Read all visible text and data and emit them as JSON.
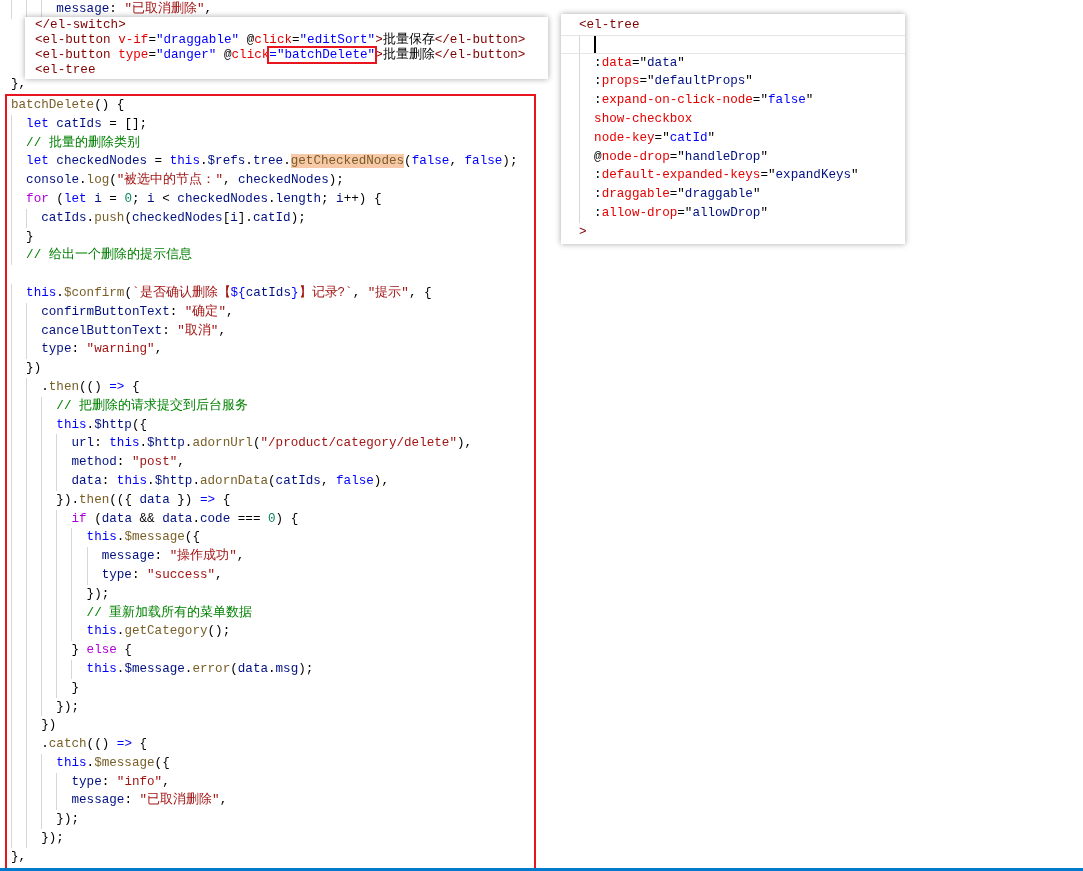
{
  "editor": {
    "top_lines": [
      {
        "kind": "code",
        "segments": [
          {
            "kind": "v",
            "text": "      message"
          },
          {
            "kind": "p",
            "text": ": "
          },
          {
            "kind": "s",
            "text": "\"已取消删除\""
          },
          {
            "kind": "p",
            "text": ","
          }
        ]
      },
      {
        "kind": "code",
        "segments": [
          {
            "kind": "p",
            "text": "},"
          }
        ]
      }
    ],
    "highlighted_block": {
      "lines": [
        {
          "kind": "code",
          "segments": [
            {
              "kind": "f",
              "text": "batchDelete"
            },
            {
              "kind": "p",
              "text": "() {"
            }
          ]
        },
        {
          "kind": "code",
          "segments": [
            {
              "kind": "kw",
              "text": "  let "
            },
            {
              "kind": "v",
              "text": "catIds"
            },
            {
              "kind": "p",
              "text": " = [];"
            }
          ]
        },
        {
          "kind": "code",
          "segments": [
            {
              "kind": "c",
              "text": "  // 批量的删除类别"
            }
          ]
        },
        {
          "kind": "code",
          "segments": [
            {
              "kind": "kw",
              "text": "  let "
            },
            {
              "kind": "v",
              "text": "checkedNodes"
            },
            {
              "kind": "p",
              "text": " = "
            },
            {
              "kind": "kw",
              "text": "this"
            },
            {
              "kind": "p",
              "text": "."
            },
            {
              "kind": "v",
              "text": "$refs"
            },
            {
              "kind": "p",
              "text": "."
            },
            {
              "kind": "v",
              "text": "tree"
            },
            {
              "kind": "p",
              "text": "."
            },
            {
              "kind": "hl",
              "text": "getCheckedNodes"
            },
            {
              "kind": "p",
              "text": "("
            },
            {
              "kind": "kw",
              "text": "false"
            },
            {
              "kind": "p",
              "text": ", "
            },
            {
              "kind": "kw",
              "text": "false"
            },
            {
              "kind": "p",
              "text": ");"
            }
          ]
        },
        {
          "kind": "code",
          "segments": [
            {
              "kind": "v",
              "text": "  console"
            },
            {
              "kind": "p",
              "text": "."
            },
            {
              "kind": "f",
              "text": "log"
            },
            {
              "kind": "p",
              "text": "("
            },
            {
              "kind": "s",
              "text": "\"被选中的节点：\""
            },
            {
              "kind": "p",
              "text": ", "
            },
            {
              "kind": "v",
              "text": "checkedNodes"
            },
            {
              "kind": "p",
              "text": ");"
            }
          ]
        },
        {
          "kind": "code",
          "segments": [
            {
              "kind": "ctl",
              "text": "  for"
            },
            {
              "kind": "p",
              "text": " ("
            },
            {
              "kind": "kw",
              "text": "let "
            },
            {
              "kind": "v",
              "text": "i"
            },
            {
              "kind": "p",
              "text": " = "
            },
            {
              "kind": "n",
              "text": "0"
            },
            {
              "kind": "p",
              "text": "; "
            },
            {
              "kind": "v",
              "text": "i"
            },
            {
              "kind": "p",
              "text": " < "
            },
            {
              "kind": "v",
              "text": "checkedNodes"
            },
            {
              "kind": "p",
              "text": "."
            },
            {
              "kind": "v",
              "text": "length"
            },
            {
              "kind": "p",
              "text": "; "
            },
            {
              "kind": "v",
              "text": "i"
            },
            {
              "kind": "p",
              "text": "++) {"
            }
          ]
        },
        {
          "kind": "code",
          "segments": [
            {
              "kind": "v",
              "text": "    catIds"
            },
            {
              "kind": "p",
              "text": "."
            },
            {
              "kind": "f",
              "text": "push"
            },
            {
              "kind": "p",
              "text": "("
            },
            {
              "kind": "v",
              "text": "checkedNodes"
            },
            {
              "kind": "p",
              "text": "["
            },
            {
              "kind": "v",
              "text": "i"
            },
            {
              "kind": "p",
              "text": "]."
            },
            {
              "kind": "v",
              "text": "catId"
            },
            {
              "kind": "p",
              "text": ");"
            }
          ]
        },
        {
          "kind": "code",
          "segments": [
            {
              "kind": "p",
              "text": "  }"
            }
          ]
        },
        {
          "kind": "code",
          "segments": [
            {
              "kind": "c",
              "text": "  // 给出一个删除的提示信息"
            }
          ]
        },
        {
          "kind": "blank"
        },
        {
          "kind": "code",
          "segments": [
            {
              "kind": "kw",
              "text": "  this"
            },
            {
              "kind": "p",
              "text": "."
            },
            {
              "kind": "f",
              "text": "$confirm"
            },
            {
              "kind": "p",
              "text": "("
            },
            {
              "kind": "s",
              "text": "`是否确认删除【"
            },
            {
              "kind": "kw",
              "text": "${"
            },
            {
              "kind": "v",
              "text": "catIds"
            },
            {
              "kind": "kw",
              "text": "}"
            },
            {
              "kind": "s",
              "text": "】记录?`"
            },
            {
              "kind": "p",
              "text": ", "
            },
            {
              "kind": "s",
              "text": "\"提示\""
            },
            {
              "kind": "p",
              "text": ", {"
            }
          ]
        },
        {
          "kind": "code",
          "segments": [
            {
              "kind": "v",
              "text": "    confirmButtonText"
            },
            {
              "kind": "p",
              "text": ": "
            },
            {
              "kind": "s",
              "text": "\"确定\""
            },
            {
              "kind": "p",
              "text": ","
            }
          ]
        },
        {
          "kind": "code",
          "segments": [
            {
              "kind": "v",
              "text": "    cancelButtonText"
            },
            {
              "kind": "p",
              "text": ": "
            },
            {
              "kind": "s",
              "text": "\"取消\""
            },
            {
              "kind": "p",
              "text": ","
            }
          ]
        },
        {
          "kind": "code",
          "segments": [
            {
              "kind": "v",
              "text": "    type"
            },
            {
              "kind": "p",
              "text": ": "
            },
            {
              "kind": "s",
              "text": "\"warning\""
            },
            {
              "kind": "p",
              "text": ","
            }
          ]
        },
        {
          "kind": "code",
          "segments": [
            {
              "kind": "p",
              "text": "  })"
            }
          ]
        },
        {
          "kind": "code",
          "segments": [
            {
              "kind": "p",
              "text": "    ."
            },
            {
              "kind": "f",
              "text": "then"
            },
            {
              "kind": "p",
              "text": "(() "
            },
            {
              "kind": "kw",
              "text": "=>"
            },
            {
              "kind": "p",
              "text": " {"
            }
          ]
        },
        {
          "kind": "code",
          "segments": [
            {
              "kind": "c",
              "text": "      // 把删除的请求提交到后台服务"
            }
          ]
        },
        {
          "kind": "code",
          "segments": [
            {
              "kind": "kw",
              "text": "      this"
            },
            {
              "kind": "p",
              "text": "."
            },
            {
              "kind": "v",
              "text": "$http"
            },
            {
              "kind": "p",
              "text": "({"
            }
          ]
        },
        {
          "kind": "code",
          "segments": [
            {
              "kind": "v",
              "text": "        url"
            },
            {
              "kind": "p",
              "text": ": "
            },
            {
              "kind": "kw",
              "text": "this"
            },
            {
              "kind": "p",
              "text": "."
            },
            {
              "kind": "v",
              "text": "$http"
            },
            {
              "kind": "p",
              "text": "."
            },
            {
              "kind": "f",
              "text": "adornUrl"
            },
            {
              "kind": "p",
              "text": "("
            },
            {
              "kind": "s",
              "text": "\"/product/category/delete\""
            },
            {
              "kind": "p",
              "text": "),"
            }
          ]
        },
        {
          "kind": "code",
          "segments": [
            {
              "kind": "v",
              "text": "        method"
            },
            {
              "kind": "p",
              "text": ": "
            },
            {
              "kind": "s",
              "text": "\"post\""
            },
            {
              "kind": "p",
              "text": ","
            }
          ]
        },
        {
          "kind": "code",
          "segments": [
            {
              "kind": "v",
              "text": "        data"
            },
            {
              "kind": "p",
              "text": ": "
            },
            {
              "kind": "kw",
              "text": "this"
            },
            {
              "kind": "p",
              "text": "."
            },
            {
              "kind": "v",
              "text": "$http"
            },
            {
              "kind": "p",
              "text": "."
            },
            {
              "kind": "f",
              "text": "adornData"
            },
            {
              "kind": "p",
              "text": "("
            },
            {
              "kind": "v",
              "text": "catIds"
            },
            {
              "kind": "p",
              "text": ", "
            },
            {
              "kind": "kw",
              "text": "false"
            },
            {
              "kind": "p",
              "text": "),"
            }
          ]
        },
        {
          "kind": "code",
          "segments": [
            {
              "kind": "p",
              "text": "      })."
            },
            {
              "kind": "f",
              "text": "then"
            },
            {
              "kind": "p",
              "text": "(({ "
            },
            {
              "kind": "v",
              "text": "data"
            },
            {
              "kind": "p",
              "text": " }) "
            },
            {
              "kind": "kw",
              "text": "=>"
            },
            {
              "kind": "p",
              "text": " {"
            }
          ]
        },
        {
          "kind": "code",
          "segments": [
            {
              "kind": "ctl",
              "text": "        if"
            },
            {
              "kind": "p",
              "text": " ("
            },
            {
              "kind": "v",
              "text": "data"
            },
            {
              "kind": "p",
              "text": " && "
            },
            {
              "kind": "v",
              "text": "data"
            },
            {
              "kind": "p",
              "text": "."
            },
            {
              "kind": "v",
              "text": "code"
            },
            {
              "kind": "p",
              "text": " === "
            },
            {
              "kind": "n",
              "text": "0"
            },
            {
              "kind": "p",
              "text": ") {"
            }
          ]
        },
        {
          "kind": "code",
          "segments": [
            {
              "kind": "kw",
              "text": "          this"
            },
            {
              "kind": "p",
              "text": "."
            },
            {
              "kind": "f",
              "text": "$message"
            },
            {
              "kind": "p",
              "text": "({"
            }
          ]
        },
        {
          "kind": "code",
          "segments": [
            {
              "kind": "v",
              "text": "            message"
            },
            {
              "kind": "p",
              "text": ": "
            },
            {
              "kind": "s",
              "text": "\"操作成功\""
            },
            {
              "kind": "p",
              "text": ","
            }
          ]
        },
        {
          "kind": "code",
          "segments": [
            {
              "kind": "v",
              "text": "            type"
            },
            {
              "kind": "p",
              "text": ": "
            },
            {
              "kind": "s",
              "text": "\"success\""
            },
            {
              "kind": "p",
              "text": ","
            }
          ]
        },
        {
          "kind": "code",
          "segments": [
            {
              "kind": "p",
              "text": "          });"
            }
          ]
        },
        {
          "kind": "code",
          "segments": [
            {
              "kind": "c",
              "text": "          // 重新加载所有的菜单数据"
            }
          ]
        },
        {
          "kind": "code",
          "segments": [
            {
              "kind": "kw",
              "text": "          this"
            },
            {
              "kind": "p",
              "text": "."
            },
            {
              "kind": "f",
              "text": "getCategory"
            },
            {
              "kind": "p",
              "text": "();"
            }
          ]
        },
        {
          "kind": "code",
          "segments": [
            {
              "kind": "p",
              "text": "        } "
            },
            {
              "kind": "ctl",
              "text": "else"
            },
            {
              "kind": "p",
              "text": " {"
            }
          ]
        },
        {
          "kind": "code",
          "segments": [
            {
              "kind": "kw",
              "text": "          this"
            },
            {
              "kind": "p",
              "text": "."
            },
            {
              "kind": "v",
              "text": "$message"
            },
            {
              "kind": "p",
              "text": "."
            },
            {
              "kind": "f",
              "text": "error"
            },
            {
              "kind": "p",
              "text": "("
            },
            {
              "kind": "v",
              "text": "data"
            },
            {
              "kind": "p",
              "text": "."
            },
            {
              "kind": "v",
              "text": "msg"
            },
            {
              "kind": "p",
              "text": ");"
            }
          ]
        },
        {
          "kind": "code",
          "segments": [
            {
              "kind": "p",
              "text": "        }"
            }
          ]
        },
        {
          "kind": "code",
          "segments": [
            {
              "kind": "p",
              "text": "      });"
            }
          ]
        },
        {
          "kind": "code",
          "segments": [
            {
              "kind": "p",
              "text": "    })"
            }
          ]
        },
        {
          "kind": "code",
          "segments": [
            {
              "kind": "p",
              "text": "    ."
            },
            {
              "kind": "f",
              "text": "catch"
            },
            {
              "kind": "p",
              "text": "(() "
            },
            {
              "kind": "kw",
              "text": "=>"
            },
            {
              "kind": "p",
              "text": " {"
            }
          ]
        },
        {
          "kind": "code",
          "segments": [
            {
              "kind": "kw",
              "text": "      this"
            },
            {
              "kind": "p",
              "text": "."
            },
            {
              "kind": "f",
              "text": "$message"
            },
            {
              "kind": "p",
              "text": "({"
            }
          ]
        },
        {
          "kind": "code",
          "segments": [
            {
              "kind": "v",
              "text": "        type"
            },
            {
              "kind": "p",
              "text": ": "
            },
            {
              "kind": "s",
              "text": "\"info\""
            },
            {
              "kind": "p",
              "text": ","
            }
          ]
        },
        {
          "kind": "code",
          "segments": [
            {
              "kind": "v",
              "text": "        message"
            },
            {
              "kind": "p",
              "text": ": "
            },
            {
              "kind": "s",
              "text": "\"已取消删除\""
            },
            {
              "kind": "p",
              "text": ","
            }
          ]
        },
        {
          "kind": "code",
          "segments": [
            {
              "kind": "p",
              "text": "      });"
            }
          ]
        },
        {
          "kind": "code",
          "segments": [
            {
              "kind": "p",
              "text": "    });"
            }
          ]
        },
        {
          "kind": "code",
          "segments": [
            {
              "kind": "p",
              "text": "},"
            }
          ]
        }
      ]
    }
  },
  "popups": [
    {
      "lines": [
        {
          "kind": "code",
          "segments": [
            {
              "kind": "tag",
              "text": "</el-switch>"
            }
          ]
        },
        {
          "kind": "code",
          "segments": [
            {
              "kind": "tag",
              "text": "<el-button "
            },
            {
              "kind": "attr",
              "text": "v-if"
            },
            {
              "kind": "p",
              "text": "="
            },
            {
              "kind": "av",
              "text": "\"draggable\""
            },
            {
              "kind": "p",
              "text": " @"
            },
            {
              "kind": "attr",
              "text": "click"
            },
            {
              "kind": "p",
              "text": "="
            },
            {
              "kind": "av",
              "text": "\"editSort\""
            },
            {
              "kind": "tag",
              "text": ">"
            },
            {
              "kind": "p",
              "text": "批量保存"
            },
            {
              "kind": "tag",
              "text": "</el-button>"
            }
          ]
        },
        {
          "kind": "code",
          "segments": [
            {
              "kind": "tag",
              "text": "<el-button "
            },
            {
              "kind": "attr",
              "text": "type"
            },
            {
              "kind": "p",
              "text": "="
            },
            {
              "kind": "av",
              "text": "\"danger\""
            },
            {
              "kind": "p",
              "text": " @"
            },
            {
              "kind": "attr",
              "text": "click"
            },
            {
              "kind": "box",
              "text": "=\"batchDelete\""
            },
            {
              "kind": "tag",
              "text": ">"
            },
            {
              "kind": "p",
              "text": "批量删除"
            },
            {
              "kind": "tag",
              "text": "</el-button>"
            }
          ]
        },
        {
          "kind": "code",
          "segments": [
            {
              "kind": "tag",
              "text": "<el-tree"
            }
          ]
        }
      ]
    },
    {
      "lines": [
        {
          "kind": "code",
          "segments": [
            {
              "kind": "tag",
              "text": "<el-tree"
            }
          ]
        },
        {
          "kind": "cursor"
        },
        {
          "kind": "code",
          "segments": [
            {
              "kind": "p",
              "text": "  :"
            },
            {
              "kind": "attr",
              "text": "data"
            },
            {
              "kind": "p",
              "text": "=\""
            },
            {
              "kind": "v",
              "text": "data"
            },
            {
              "kind": "p",
              "text": "\""
            }
          ]
        },
        {
          "kind": "code",
          "segments": [
            {
              "kind": "p",
              "text": "  :"
            },
            {
              "kind": "attr",
              "text": "props"
            },
            {
              "kind": "p",
              "text": "=\""
            },
            {
              "kind": "v",
              "text": "defaultProps"
            },
            {
              "kind": "p",
              "text": "\""
            }
          ]
        },
        {
          "kind": "code",
          "segments": [
            {
              "kind": "p",
              "text": "  :"
            },
            {
              "kind": "attr",
              "text": "expand-on-click-node"
            },
            {
              "kind": "p",
              "text": "=\""
            },
            {
              "kind": "kw",
              "text": "false"
            },
            {
              "kind": "p",
              "text": "\""
            }
          ]
        },
        {
          "kind": "code",
          "segments": [
            {
              "kind": "attr",
              "text": "  show-checkbox"
            }
          ]
        },
        {
          "kind": "code",
          "segments": [
            {
              "kind": "attr",
              "text": "  node-key"
            },
            {
              "kind": "p",
              "text": "=\""
            },
            {
              "kind": "kw",
              "text": "catId"
            },
            {
              "kind": "p",
              "text": "\""
            }
          ]
        },
        {
          "kind": "code",
          "segments": [
            {
              "kind": "p",
              "text": "  @"
            },
            {
              "kind": "attr",
              "text": "node-drop"
            },
            {
              "kind": "p",
              "text": "=\""
            },
            {
              "kind": "v",
              "text": "handleDrop"
            },
            {
              "kind": "p",
              "text": "\""
            }
          ]
        },
        {
          "kind": "code",
          "segments": [
            {
              "kind": "p",
              "text": "  :"
            },
            {
              "kind": "attr",
              "text": "default-expanded-keys"
            },
            {
              "kind": "p",
              "text": "=\""
            },
            {
              "kind": "v",
              "text": "expandKeys"
            },
            {
              "kind": "p",
              "text": "\""
            }
          ]
        },
        {
          "kind": "code",
          "segments": [
            {
              "kind": "p",
              "text": "  :"
            },
            {
              "kind": "attr",
              "text": "draggable"
            },
            {
              "kind": "p",
              "text": "=\""
            },
            {
              "kind": "v",
              "text": "draggable"
            },
            {
              "kind": "p",
              "text": "\""
            }
          ]
        },
        {
          "kind": "code",
          "segments": [
            {
              "kind": "p",
              "text": "  :"
            },
            {
              "kind": "attr",
              "text": "allow-drop"
            },
            {
              "kind": "p",
              "text": "=\""
            },
            {
              "kind": "v",
              "text": "allowDrop"
            },
            {
              "kind": "p",
              "text": "\""
            }
          ]
        },
        {
          "kind": "code",
          "segments": [
            {
              "kind": "tag",
              "text": ">"
            }
          ]
        }
      ]
    }
  ]
}
